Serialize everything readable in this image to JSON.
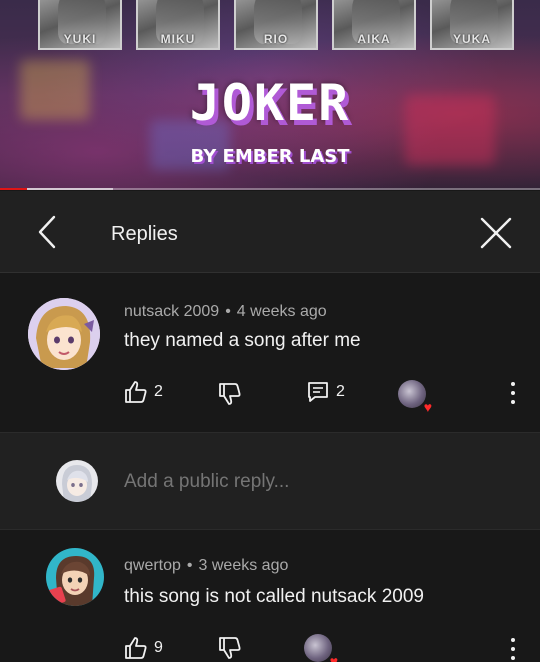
{
  "video": {
    "portraits": [
      "YUKI",
      "MIKU",
      "RIO",
      "AIKA",
      "YUKA"
    ],
    "title": "JOKER",
    "subtitle": "BY EMBER LAST",
    "progress": 0.05,
    "buffered": 0.21,
    "accent_color": "#e01515"
  },
  "replies_panel": {
    "title": "Replies",
    "back_icon": "chevron-left-icon",
    "close_icon": "close-icon"
  },
  "parent_comment": {
    "author": "nutsack 2009",
    "separator": "•",
    "time": "4 weeks ago",
    "text": "they named a song after me",
    "likes": "2",
    "replies": "2"
  },
  "add_reply": {
    "placeholder": "Add a public reply..."
  },
  "reply_comment": {
    "author": "qwertop",
    "separator": "•",
    "time": "3 weeks ago",
    "text": "this song is not called nutsack 2009",
    "likes": "9"
  },
  "colors": {
    "background": "#181818",
    "panel": "#212121",
    "secondary_text": "#aaaaaa",
    "heart": "#ff2a2a"
  }
}
